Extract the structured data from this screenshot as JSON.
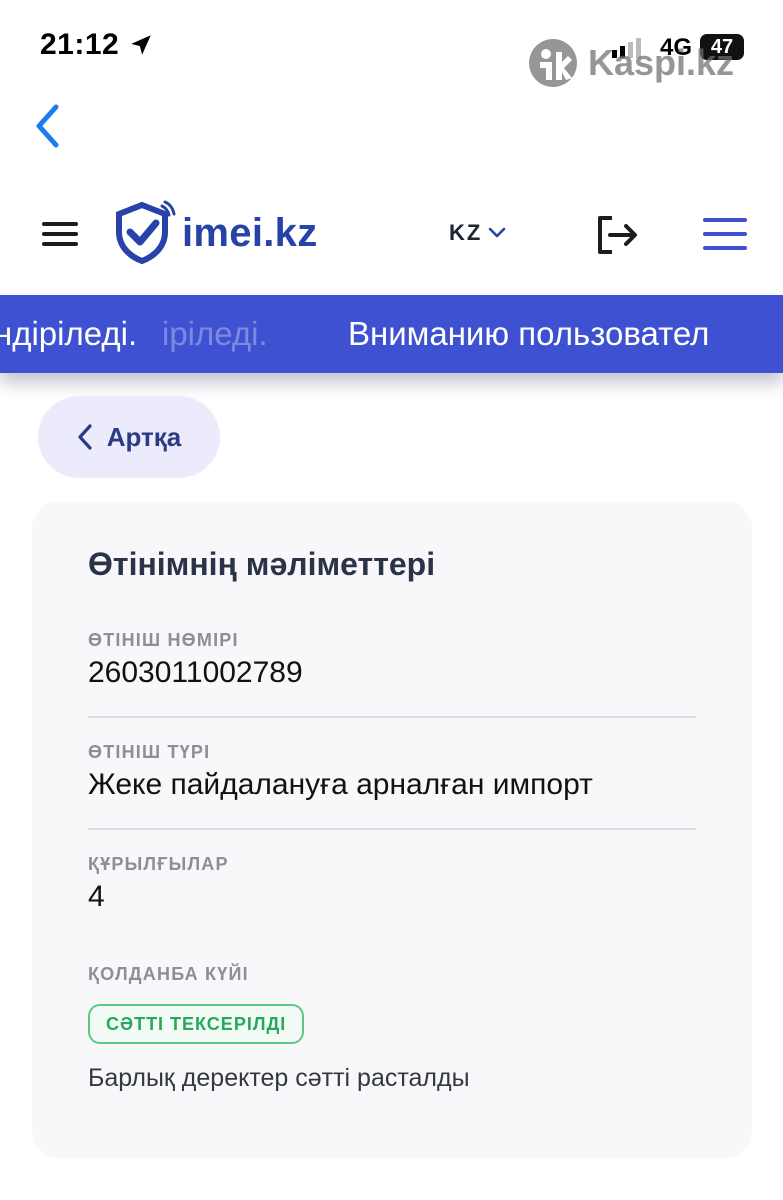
{
  "status_bar": {
    "time": "21:12",
    "network": "4G",
    "battery": "47"
  },
  "watermark": {
    "text": "Kaspi.kz",
    "icon": "kaspi-logo-icon"
  },
  "navigation": {
    "back_icon": "chevron-left-icon"
  },
  "header": {
    "menu_icon": "hamburger-icon",
    "logo_text": "imei.kz",
    "logo_icon": "shield-check-icon",
    "language": "KZ",
    "language_icon": "chevron-down-icon",
    "logout_icon": "logout-icon",
    "menu_right_icon": "menu-icon",
    "brand_color": "#2742a8"
  },
  "banner": {
    "text_left": "ндіріледі.",
    "text_ghost": "іріледі.",
    "text_right": "Вниманию пользовател",
    "color": "#3e51d1"
  },
  "back_button": {
    "label": "Артқа",
    "icon": "chevron-left-icon"
  },
  "details": {
    "title": "Өтінімнің мәліметтері",
    "fields": [
      {
        "label": "ӨТІНІШ НӨМІРІ",
        "value": "2603011002789"
      },
      {
        "label": "ӨТІНІШ ТҮРІ",
        "value": "Жеке пайдалануға арналған импорт"
      },
      {
        "label": "ҚҰРЫЛҒЫЛАР",
        "value": "4"
      }
    ],
    "status_label": "ҚОЛДАНБА КҮЙІ",
    "status_badge": "СӘТТІ ТЕКСЕРІЛДІ",
    "status_color": "#28a85a",
    "status_note": "Барлық деректер сәтті расталды"
  }
}
